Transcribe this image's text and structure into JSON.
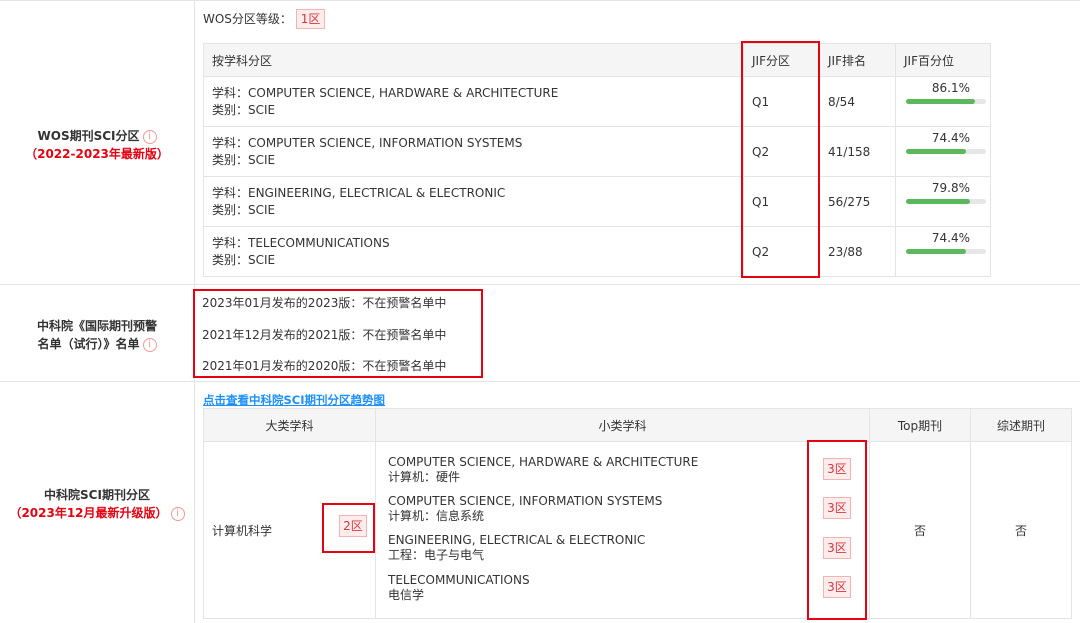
{
  "wos": {
    "label": "WOS期刊SCI分区",
    "edition": "（2022-2023年最新版）",
    "level_label": "WOS分区等级：",
    "level_value": "1区",
    "headers": [
      "按学科分区",
      "JIF分区",
      "JIF排名",
      "JIF百分位"
    ],
    "rows": [
      {
        "subject": "学科：COMPUTER SCIENCE, HARDWARE & ARCHITECTURE",
        "category": "类别：SCIE",
        "quartile": "Q1",
        "rank": "8/54",
        "percentile_text": "86.1%",
        "percentile": 86.1
      },
      {
        "subject": "学科：COMPUTER SCIENCE, INFORMATION SYSTEMS",
        "category": "类别：SCIE",
        "quartile": "Q2",
        "rank": "41/158",
        "percentile_text": "74.4%",
        "percentile": 74.4
      },
      {
        "subject": "学科：ENGINEERING, ELECTRICAL & ELECTRONIC",
        "category": "类别：SCIE",
        "quartile": "Q1",
        "rank": "56/275",
        "percentile_text": "79.8%",
        "percentile": 79.8
      },
      {
        "subject": "学科：TELECOMMUNICATIONS",
        "category": "类别：SCIE",
        "quartile": "Q2",
        "rank": "23/88",
        "percentile_text": "74.4%",
        "percentile": 74.4
      }
    ]
  },
  "warning": {
    "label_line1": "中科院《国际期刊预警",
    "label_line2": "名单（试行）》名单",
    "lines": [
      "2023年01月发布的2023版：不在预警名单中",
      "2021年12月发布的2021版：不在预警名单中",
      "2021年01月发布的2020版：不在预警名单中"
    ]
  },
  "cas": {
    "label": "中科院SCI期刊分区",
    "edition": "（2023年12月最新升级版）",
    "trend_link": "点击查看中科院SCI期刊分区趋势图",
    "headers": [
      "大类学科",
      "小类学科",
      "Top期刊",
      "综述期刊"
    ],
    "major_subject": "计算机科学",
    "major_zone": "2区",
    "sub_items": [
      {
        "en": "COMPUTER SCIENCE, HARDWARE & ARCHITECTURE",
        "cn": "计算机：硬件",
        "zone": "3区"
      },
      {
        "en": "COMPUTER SCIENCE, INFORMATION SYSTEMS",
        "cn": "计算机：信息系统",
        "zone": "3区"
      },
      {
        "en": "ENGINEERING, ELECTRICAL & ELECTRONIC",
        "cn": "工程：电子与电气",
        "zone": "3区"
      },
      {
        "en": "TELECOMMUNICATIONS",
        "cn": "电信学",
        "zone": "3区"
      }
    ],
    "top": "否",
    "review": "否"
  },
  "colors": {
    "accent_red": "#e60012",
    "bar_green": "#5cb85c",
    "link_blue": "#1e90ff"
  },
  "icons": {
    "info": "info-circle-icon"
  }
}
